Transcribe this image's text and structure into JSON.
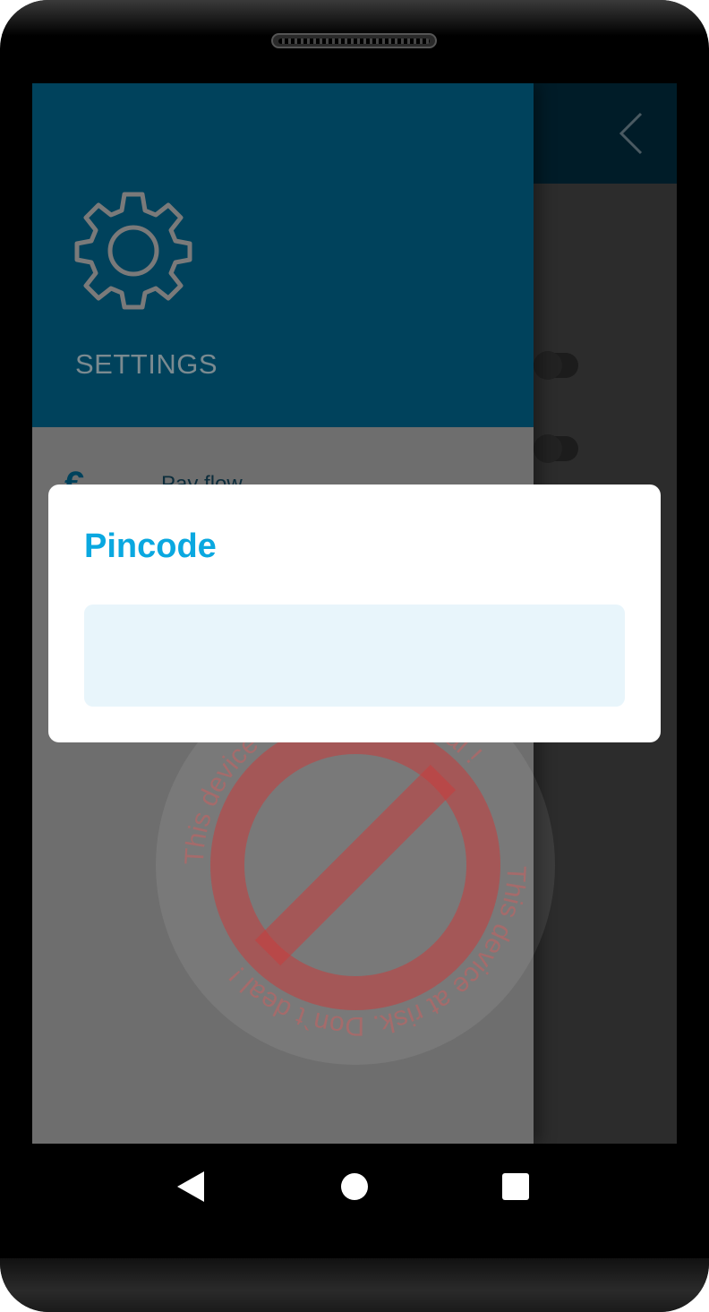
{
  "drawer": {
    "title": "SETTINGS",
    "items": [
      {
        "label": "Pay flow",
        "icon": "euro-icon"
      }
    ]
  },
  "dialog": {
    "title": "Pincode",
    "input_value": "",
    "input_placeholder": ""
  },
  "watermark": {
    "text": "This device at risk. Don`t deal !",
    "icon": "prohibited-icon"
  },
  "colors": {
    "drawer_header": "#00425c",
    "dialog_title": "#0aa8e0",
    "input_background": "#e8f5fb",
    "watermark": "#e05050"
  },
  "nav": {
    "back_icon": "back-triangle-icon",
    "home_icon": "home-circle-icon",
    "recents_icon": "recents-square-icon"
  }
}
